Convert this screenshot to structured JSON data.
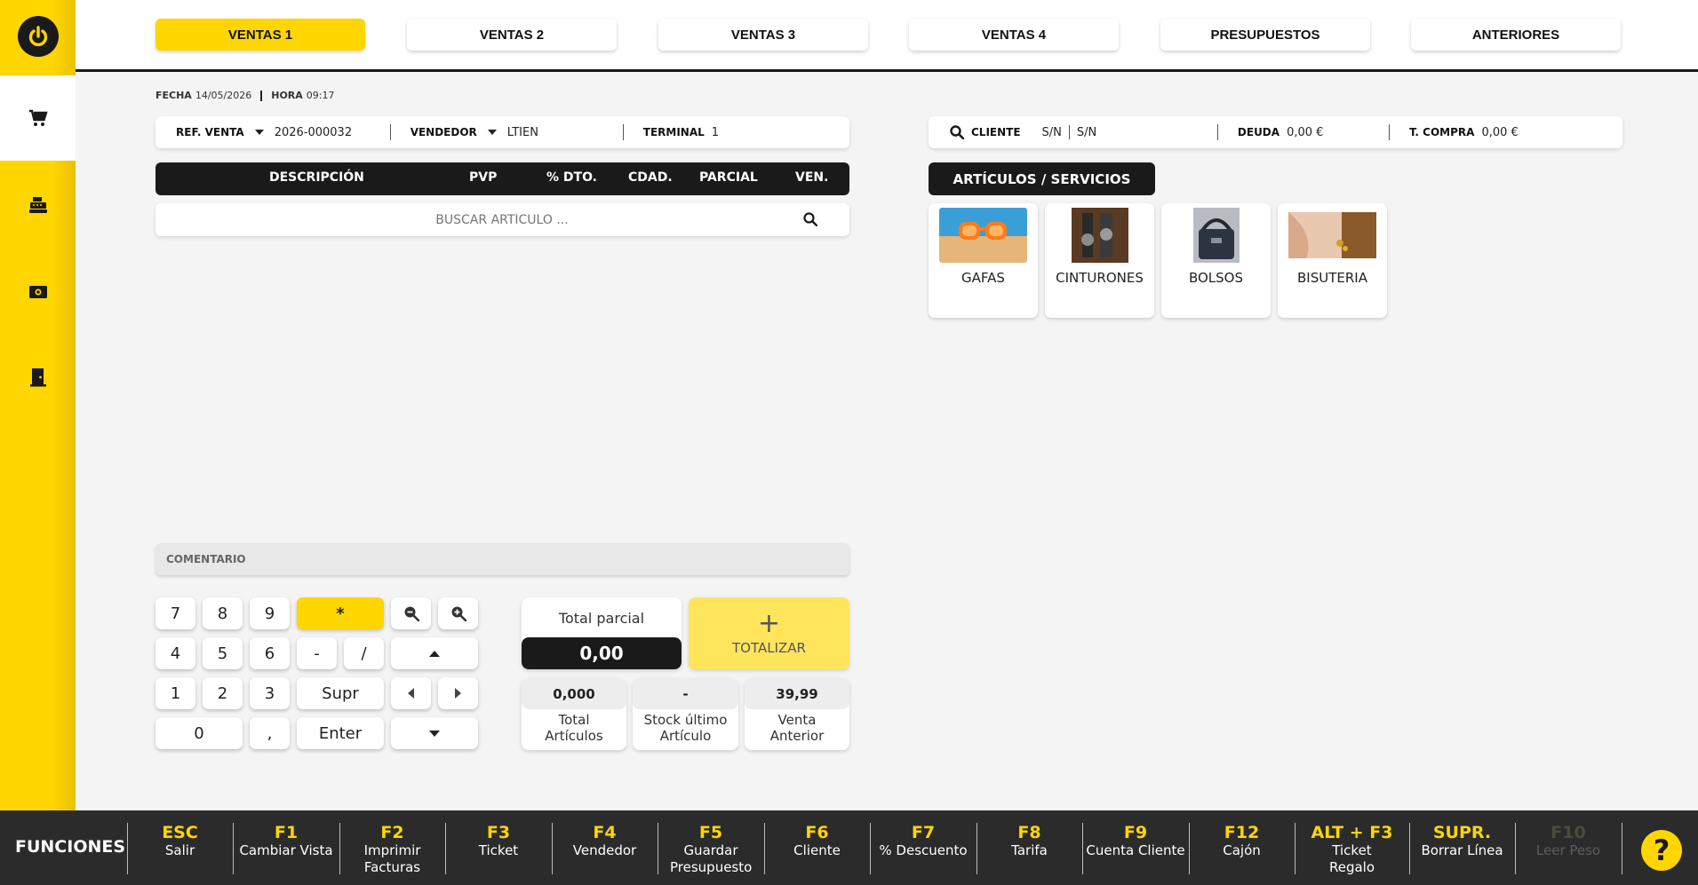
{
  "tabs": [
    "VENTAS 1",
    "VENTAS 2",
    "VENTAS 3",
    "VENTAS 4",
    "PRESUPUESTOS",
    "ANTERIORES"
  ],
  "active_tab": "VENTAS 1",
  "datetime": {
    "fecha_label": "FECHA",
    "fecha": "14/05/2026",
    "hora_label": "HORA",
    "hora": "09:17"
  },
  "sale_info": {
    "ref_label": "REF. VENTA",
    "ref_value": "2026-000032",
    "vendedor_label": "VENDEDOR",
    "vendedor_value": "LTIEN",
    "terminal_label": "TERMINAL",
    "terminal_value": "1"
  },
  "client_info": {
    "cliente_label": "CLIENTE",
    "cliente_value1": "S/N",
    "cliente_value2": "S/N",
    "deuda_label": "DEUDA",
    "deuda_value": "0,00 €",
    "tcompra_label": "T. COMPRA",
    "tcompra_value": "0,00 €"
  },
  "table": {
    "columns": [
      "DESCRIPCIÓN",
      "PVP",
      "% DTO.",
      "CDAD.",
      "PARCIAL",
      "VEN."
    ]
  },
  "search": {
    "placeholder": "BUSCAR ARTÍCULO ..."
  },
  "comment": {
    "placeholder": "COMENTARIO"
  },
  "keypad": {
    "keys": [
      "7",
      "8",
      "9",
      "*",
      "4",
      "5",
      "6",
      "-",
      "/",
      "1",
      "2",
      "3",
      "Supr",
      "0",
      ",",
      "Enter"
    ]
  },
  "totals": {
    "parcial_label": "Total parcial",
    "parcial_value": "0,00",
    "totalizar_label": "TOTALIZAR",
    "stats": [
      {
        "value": "0,000",
        "label": "Total Artículos"
      },
      {
        "value": "-",
        "label": "Stock último Artículo"
      },
      {
        "value": "39,99",
        "label": "Venta Anterior"
      }
    ]
  },
  "categories": {
    "header": "ARTÍCULOS / SERVICIOS",
    "items": [
      "GAFAS",
      "CINTURONES",
      "BOLSOS",
      "BISUTERIA"
    ]
  },
  "footer": {
    "title": "FUNCIONES",
    "keys": [
      {
        "key": "ESC",
        "desc": "Salir"
      },
      {
        "key": "F1",
        "desc": "Cambiar Vista"
      },
      {
        "key": "F2",
        "desc": "Imprimir Facturas"
      },
      {
        "key": "F3",
        "desc": "Ticket"
      },
      {
        "key": "F4",
        "desc": "Vendedor"
      },
      {
        "key": "F5",
        "desc": "Guardar Presupuesto"
      },
      {
        "key": "F6",
        "desc": "Cliente"
      },
      {
        "key": "F7",
        "desc": "% Descuento"
      },
      {
        "key": "F8",
        "desc": "Tarifa"
      },
      {
        "key": "F9",
        "desc": "Cuenta Cliente"
      },
      {
        "key": "F12",
        "desc": "Cajón"
      },
      {
        "key": "ALT + F3",
        "desc": "Ticket Regalo"
      },
      {
        "key": "SUPR.",
        "desc": "Borrar Línea"
      },
      {
        "key": "F10",
        "desc": "Leer Peso"
      }
    ],
    "help": "?"
  },
  "colors": {
    "accent": "#ffd600",
    "dark": "#1a1a1a",
    "footer_bg": "#2b2b2b"
  }
}
